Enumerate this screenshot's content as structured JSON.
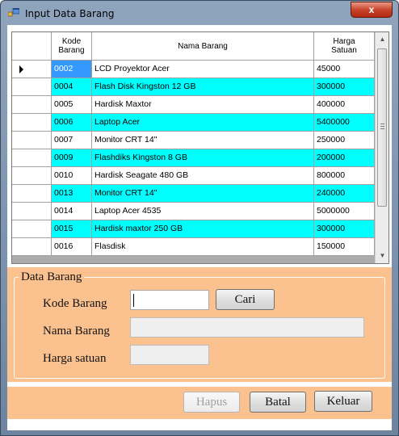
{
  "window": {
    "title": "Input Data Barang",
    "close_label": "x"
  },
  "grid": {
    "columns": [
      "Kode\nBarang",
      "Nama Barang",
      "Harga\nSatuan"
    ],
    "rows": [
      {
        "kode": "0002",
        "nama": "LCD Proyektor Acer",
        "harga": "45000",
        "color": "#ffffff",
        "selected": true
      },
      {
        "kode": "0004",
        "nama": "Flash Disk Kingston 12 GB",
        "harga": "300000",
        "color": "#00ffff"
      },
      {
        "kode": "0005",
        "nama": "Hardisk Maxtor",
        "harga": "400000",
        "color": "#ffffff"
      },
      {
        "kode": "0006",
        "nama": "Laptop Acer",
        "harga": "5400000",
        "color": "#00ffff"
      },
      {
        "kode": "0007",
        "nama": "Monitor CRT 14\"",
        "harga": "250000",
        "color": "#ffffff"
      },
      {
        "kode": "0009",
        "nama": "Flashdiks Kingston 8 GB",
        "harga": "200000",
        "color": "#00ffff"
      },
      {
        "kode": "0010",
        "nama": "Hardisk Seagate 480 GB",
        "harga": "800000",
        "color": "#ffffff"
      },
      {
        "kode": "0013",
        "nama": "Monitor CRT 14\"",
        "harga": "240000",
        "color": "#00ffff"
      },
      {
        "kode": "0014",
        "nama": "Laptop Acer 4535",
        "harga": "5000000",
        "color": "#ffffff"
      },
      {
        "kode": "0015",
        "nama": "Hardisk maxtor 250 GB",
        "harga": "300000",
        "color": "#00ffff"
      },
      {
        "kode": "0016",
        "nama": "Flasdisk",
        "harga": "150000",
        "color": "#ffffff"
      }
    ],
    "selected_cell_color": "#3399ff"
  },
  "form": {
    "group_title": "Data Barang",
    "kode_label": "Kode Barang",
    "nama_label": "Nama Barang",
    "harga_label": "Harga satuan",
    "kode_value": "",
    "nama_value": "",
    "harga_value": "",
    "cari_label": "Cari"
  },
  "buttons": {
    "hapus": "Hapus",
    "batal": "Batal",
    "keluar": "Keluar"
  },
  "colors": {
    "panel": "#fbc18f",
    "alt_row": "#00ffff"
  }
}
